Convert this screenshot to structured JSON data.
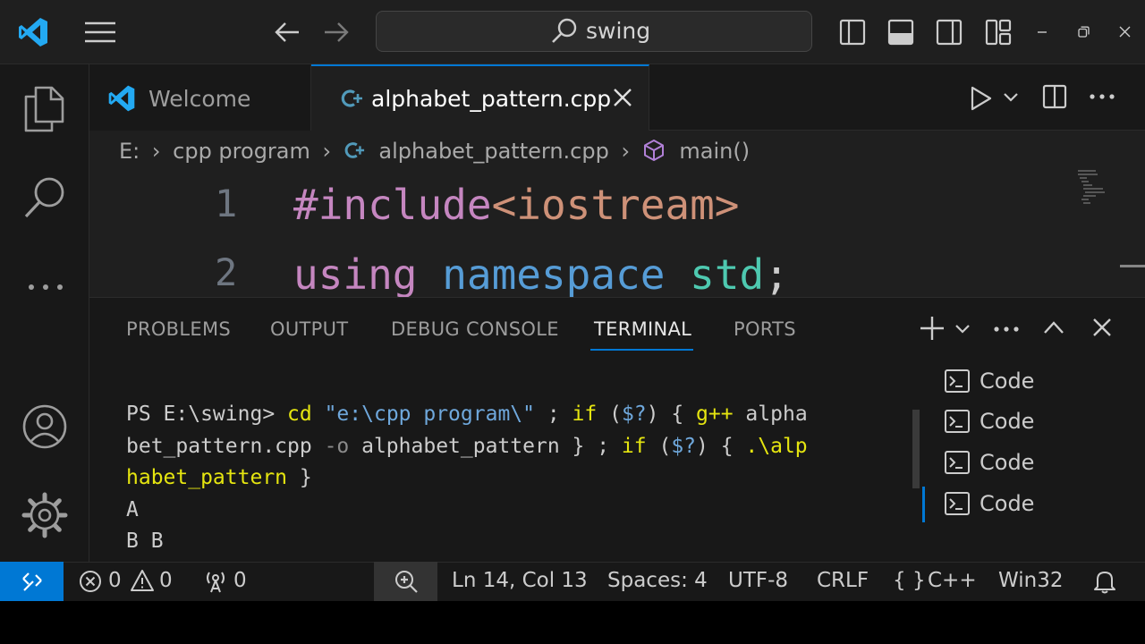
{
  "titlebar": {
    "search_text": "swing"
  },
  "tabs": [
    {
      "label": "Welcome",
      "active": false
    },
    {
      "label": "alphabet_pattern.cpp",
      "active": true
    }
  ],
  "breadcrumb": {
    "drive": "E:",
    "folder": "cpp program",
    "file": "alphabet_pattern.cpp",
    "symbol": "main()"
  },
  "editor": {
    "lines": [
      {
        "number": "1",
        "tokens": [
          {
            "text": "#include",
            "color": "#c586c0"
          },
          {
            "text": "<iostream>",
            "color": "#ce9178"
          }
        ]
      },
      {
        "number": "2",
        "tokens": [
          {
            "text": "using",
            "color": "#c586c0"
          },
          {
            "text": " ",
            "color": "#cccccc"
          },
          {
            "text": "namespace",
            "color": "#569cd6"
          },
          {
            "text": " ",
            "color": "#cccccc"
          },
          {
            "text": "std",
            "color": "#4ec9b0"
          },
          {
            "text": ";",
            "color": "#cccccc"
          }
        ]
      }
    ]
  },
  "panel": {
    "tabs": [
      "PROBLEMS",
      "OUTPUT",
      "DEBUG CONSOLE",
      "TERMINAL",
      "PORTS"
    ],
    "active_tab": "TERMINAL",
    "terminal_lines": [
      [
        {
          "text": "PS E:\\swing> ",
          "color": "#cccccc"
        },
        {
          "text": "cd",
          "color": "#e5e510"
        },
        {
          "text": " ",
          "color": "#cccccc"
        },
        {
          "text": "\"e:\\cpp program\\\"",
          "color": "#6fa8dc"
        },
        {
          "text": " ; ",
          "color": "#cccccc"
        },
        {
          "text": "if",
          "color": "#e5e510"
        },
        {
          "text": " (",
          "color": "#cccccc"
        },
        {
          "text": "$?",
          "color": "#6fa8dc"
        },
        {
          "text": ") { ",
          "color": "#cccccc"
        },
        {
          "text": "g++",
          "color": "#e5e510"
        },
        {
          "text": " alpha",
          "color": "#cccccc"
        }
      ],
      [
        {
          "text": "bet_pattern.cpp ",
          "color": "#cccccc"
        },
        {
          "text": "-o",
          "color": "#8a8a8a"
        },
        {
          "text": " alphabet_pattern } ; ",
          "color": "#cccccc"
        },
        {
          "text": "if",
          "color": "#e5e510"
        },
        {
          "text": " (",
          "color": "#cccccc"
        },
        {
          "text": "$?",
          "color": "#6fa8dc"
        },
        {
          "text": ") { ",
          "color": "#cccccc"
        },
        {
          "text": ".\\alp",
          "color": "#e5e510"
        }
      ],
      [
        {
          "text": "habet_pattern",
          "color": "#e5e510"
        },
        {
          "text": " }",
          "color": "#cccccc"
        }
      ],
      [
        {
          "text": "A",
          "color": "#cccccc"
        }
      ],
      [
        {
          "text": "B B",
          "color": "#cccccc"
        }
      ]
    ],
    "terminal_list": [
      "Code",
      "Code",
      "Code",
      "Code"
    ]
  },
  "statusbar": {
    "errors": "0",
    "warnings": "0",
    "ports": "0",
    "position": "Ln 14, Col 13",
    "spaces": "Spaces: 4",
    "encoding": "UTF-8",
    "eol": "CRLF",
    "language": "C++",
    "platform": "Win32"
  },
  "colors": {
    "accent": "#0078d4",
    "cpp_icon": "#519aba",
    "vscode_logo": "#23a9f2",
    "symbol_icon": "#b180d7"
  }
}
